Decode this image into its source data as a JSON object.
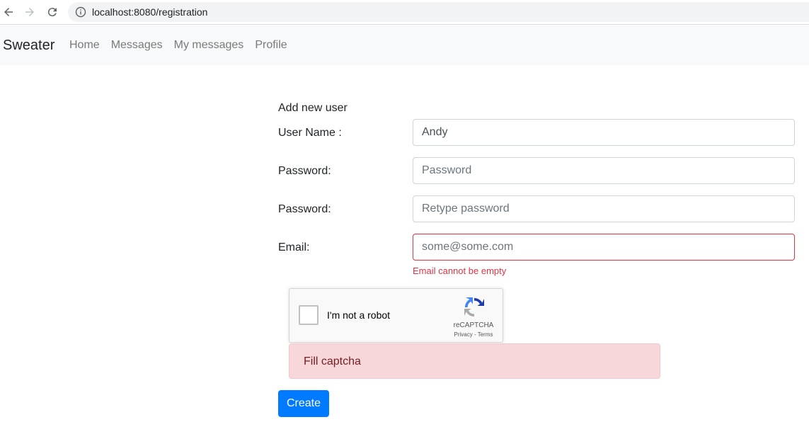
{
  "browser": {
    "url": "localhost:8080/registration"
  },
  "navbar": {
    "brand": "Sweater",
    "links": [
      "Home",
      "Messages",
      "My messages",
      "Profile"
    ]
  },
  "form": {
    "title": "Add new user",
    "username": {
      "label": "User Name :",
      "value": "Andy"
    },
    "password": {
      "label": "Password:",
      "placeholder": "Password"
    },
    "password2": {
      "label": "Password:",
      "placeholder": "Retype password"
    },
    "email": {
      "label": "Email:",
      "placeholder": "some@some.com",
      "error": "Email cannot be empty"
    },
    "recaptcha": {
      "label": "I'm not a robot",
      "brand": "reCAPTCHA",
      "links": "Privacy - Terms"
    },
    "alert": "Fill captcha",
    "submit_label": "Create"
  },
  "colors": {
    "primary": "#007bff",
    "danger": "#dc3545",
    "alert_bg": "#f8d7da",
    "alert_text": "#721c24",
    "navbar_bg": "#f8f9fa"
  }
}
